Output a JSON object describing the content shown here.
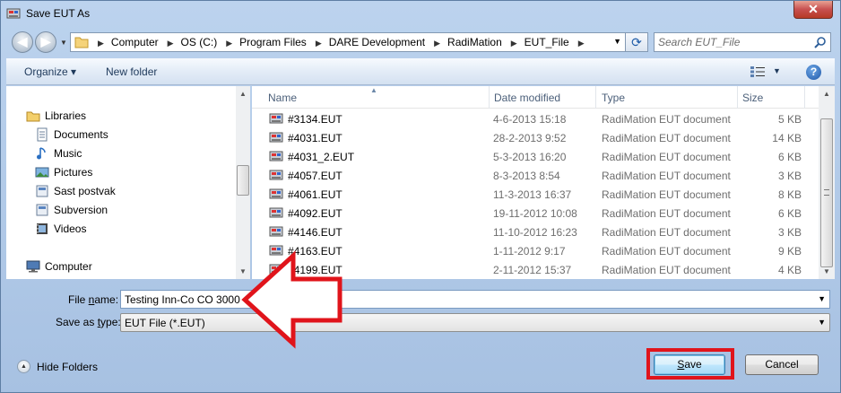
{
  "window": {
    "title": "Save EUT As",
    "close_label": "✕"
  },
  "address_bar": {
    "crumbs": [
      "Computer",
      "OS (C:)",
      "Program Files",
      "DARE Development",
      "RadiMation",
      "EUT_File"
    ],
    "search_placeholder": "Search EUT_File"
  },
  "toolbar": {
    "organize_label": "Organize ▾",
    "new_folder_label": "New folder"
  },
  "nav_pane": {
    "items": [
      {
        "label": "Libraries",
        "icon": "libraries-icon"
      },
      {
        "label": "Documents",
        "icon": "documents-icon"
      },
      {
        "label": "Music",
        "icon": "music-icon"
      },
      {
        "label": "Pictures",
        "icon": "pictures-icon"
      },
      {
        "label": "Sast postvak",
        "icon": "library-folder-icon"
      },
      {
        "label": "Subversion",
        "icon": "library-folder-icon"
      },
      {
        "label": "Videos",
        "icon": "videos-icon"
      },
      {
        "label": "Computer",
        "icon": "computer-icon"
      }
    ]
  },
  "file_list": {
    "columns": {
      "name": "Name",
      "date": "Date modified",
      "type": "Type",
      "size": "Size"
    },
    "rows": [
      {
        "name": "#3134.EUT",
        "date": "4-6-2013 15:18",
        "type": "RadiMation EUT document",
        "size": "5 KB"
      },
      {
        "name": "#4031.EUT",
        "date": "28-2-2013 9:52",
        "type": "RadiMation EUT document",
        "size": "14 KB"
      },
      {
        "name": "#4031_2.EUT",
        "date": "5-3-2013 16:20",
        "type": "RadiMation EUT document",
        "size": "6 KB"
      },
      {
        "name": "#4057.EUT",
        "date": "8-3-2013 8:54",
        "type": "RadiMation EUT document",
        "size": "3 KB"
      },
      {
        "name": "#4061.EUT",
        "date": "11-3-2013 16:37",
        "type": "RadiMation EUT document",
        "size": "8 KB"
      },
      {
        "name": "#4092.EUT",
        "date": "19-11-2012 10:08",
        "type": "RadiMation EUT document",
        "size": "6 KB"
      },
      {
        "name": "#4146.EUT",
        "date": "11-10-2012 16:23",
        "type": "RadiMation EUT document",
        "size": "3 KB"
      },
      {
        "name": "#4163.EUT",
        "date": "1-11-2012 9:17",
        "type": "RadiMation EUT document",
        "size": "9 KB"
      },
      {
        "name": "#4199.EUT",
        "date": "2-11-2012 15:37",
        "type": "RadiMation EUT document",
        "size": "4 KB"
      }
    ]
  },
  "form": {
    "file_name_label_pre": "File ",
    "file_name_label_ul": "n",
    "file_name_label_post": "ame:",
    "file_name_value": "Testing Inn-Co CO 3000",
    "save_type_label_pre": "Save as ",
    "save_type_label_ul": "t",
    "save_type_label_post": "ype:",
    "save_type_value": "EUT File (*.EUT)"
  },
  "footer": {
    "hide_folders_label": "Hide Folders",
    "save_label_ul": "S",
    "save_label_post": "ave",
    "cancel_label": "Cancel"
  },
  "colors": {
    "highlight": "#e0141b",
    "accent": "#1f5ca8"
  }
}
